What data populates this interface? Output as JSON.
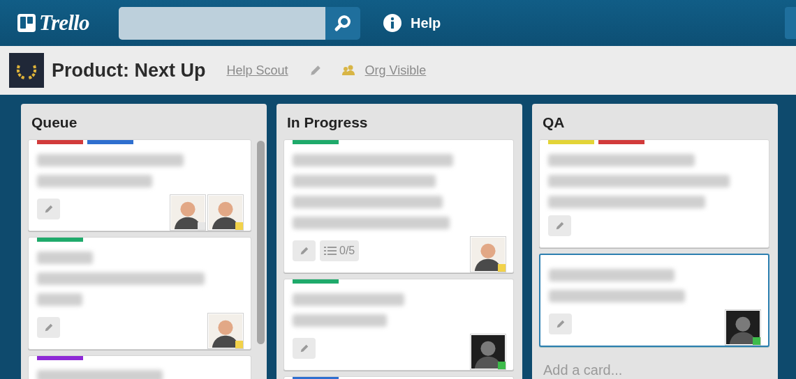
{
  "header": {
    "logo": "Trello",
    "help": "Help"
  },
  "board": {
    "title": "Product: Next Up",
    "organization": "Help Scout",
    "visibility": "Org Visible"
  },
  "lists": [
    {
      "name": "Queue",
      "scrollbar": true,
      "cards": [
        {
          "labels": [
            {
              "color": "#d23b3b"
            },
            {
              "color": "#2f6fcf"
            }
          ],
          "selected": false,
          "badges": [
            {
              "kind": "edit"
            }
          ],
          "members": [
            {
              "kind": "light",
              "color": "#e6e6e6"
            },
            {
              "kind": "light",
              "color": "#f2d24a"
            }
          ]
        },
        {
          "labels": [
            {
              "color": "#1faa6b"
            }
          ],
          "selected": false,
          "badges": [
            {
              "kind": "edit"
            }
          ],
          "members": [
            {
              "kind": "light",
              "color": "#f2d24a"
            }
          ]
        },
        {
          "labels": [
            {
              "color": "#8e2ad6"
            }
          ],
          "selected": false
        }
      ]
    },
    {
      "name": "In Progress",
      "scrollbar": false,
      "cards": [
        {
          "labels": [
            {
              "color": "#1faa6b"
            }
          ],
          "selected": false,
          "badges": [
            {
              "kind": "edit"
            },
            {
              "kind": "checklist",
              "text": "0/5"
            }
          ],
          "members": [
            {
              "kind": "light",
              "color": "#f2d24a"
            }
          ]
        },
        {
          "labels": [
            {
              "color": "#1faa6b"
            }
          ],
          "selected": false,
          "badges": [
            {
              "kind": "edit"
            }
          ],
          "members": [
            {
              "kind": "dark",
              "color": "#3dbb4a"
            }
          ]
        },
        {
          "labels": [
            {
              "color": "#2f6fcf"
            }
          ],
          "selected": false
        }
      ]
    },
    {
      "name": "QA",
      "scrollbar": false,
      "add_card": "Add a card...",
      "cards": [
        {
          "labels": [
            {
              "color": "#e3d437"
            },
            {
              "color": "#d23b3b"
            }
          ],
          "selected": false,
          "badges": [
            {
              "kind": "edit"
            }
          ]
        },
        {
          "selected": true,
          "badges": [
            {
              "kind": "edit"
            }
          ],
          "members": [
            {
              "kind": "dark",
              "color": "#3dbb4a"
            }
          ]
        }
      ]
    }
  ]
}
